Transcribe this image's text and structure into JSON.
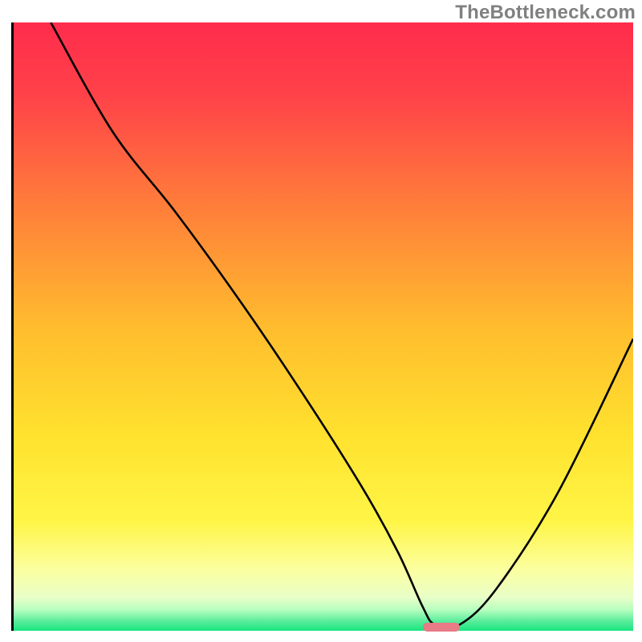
{
  "watermark": "TheBottleneck.com",
  "colors": {
    "gradient_stops": [
      {
        "offset": 0.0,
        "color": "#ff2c4c"
      },
      {
        "offset": 0.12,
        "color": "#ff4249"
      },
      {
        "offset": 0.3,
        "color": "#ff7d3a"
      },
      {
        "offset": 0.5,
        "color": "#ffbc2e"
      },
      {
        "offset": 0.68,
        "color": "#ffe22e"
      },
      {
        "offset": 0.82,
        "color": "#fff547"
      },
      {
        "offset": 0.9,
        "color": "#fbffa0"
      },
      {
        "offset": 0.945,
        "color": "#e9ffc8"
      },
      {
        "offset": 0.965,
        "color": "#b8ffbf"
      },
      {
        "offset": 0.985,
        "color": "#57ec9a"
      },
      {
        "offset": 1.0,
        "color": "#19e681"
      }
    ],
    "curve": "#000000",
    "axis": "#000000",
    "marker": "#e77b86",
    "watermark": "#808080"
  },
  "chart_data": {
    "type": "line",
    "title": "",
    "xlabel": "",
    "ylabel": "",
    "xlim": [
      0,
      100
    ],
    "ylim": [
      0,
      100
    ],
    "grid": false,
    "series": [
      {
        "name": "bottleneck-curve",
        "x": [
          6,
          16,
          26,
          36,
          46,
          56,
          62,
          66,
          68,
          72,
          78,
          88,
          100
        ],
        "values": [
          100,
          82,
          69,
          55,
          40,
          24,
          13,
          4,
          1,
          1,
          7,
          23,
          48
        ]
      }
    ],
    "marker": {
      "x_start": 66,
      "x_end": 72,
      "y": 0.6,
      "height": 1.5
    }
  }
}
